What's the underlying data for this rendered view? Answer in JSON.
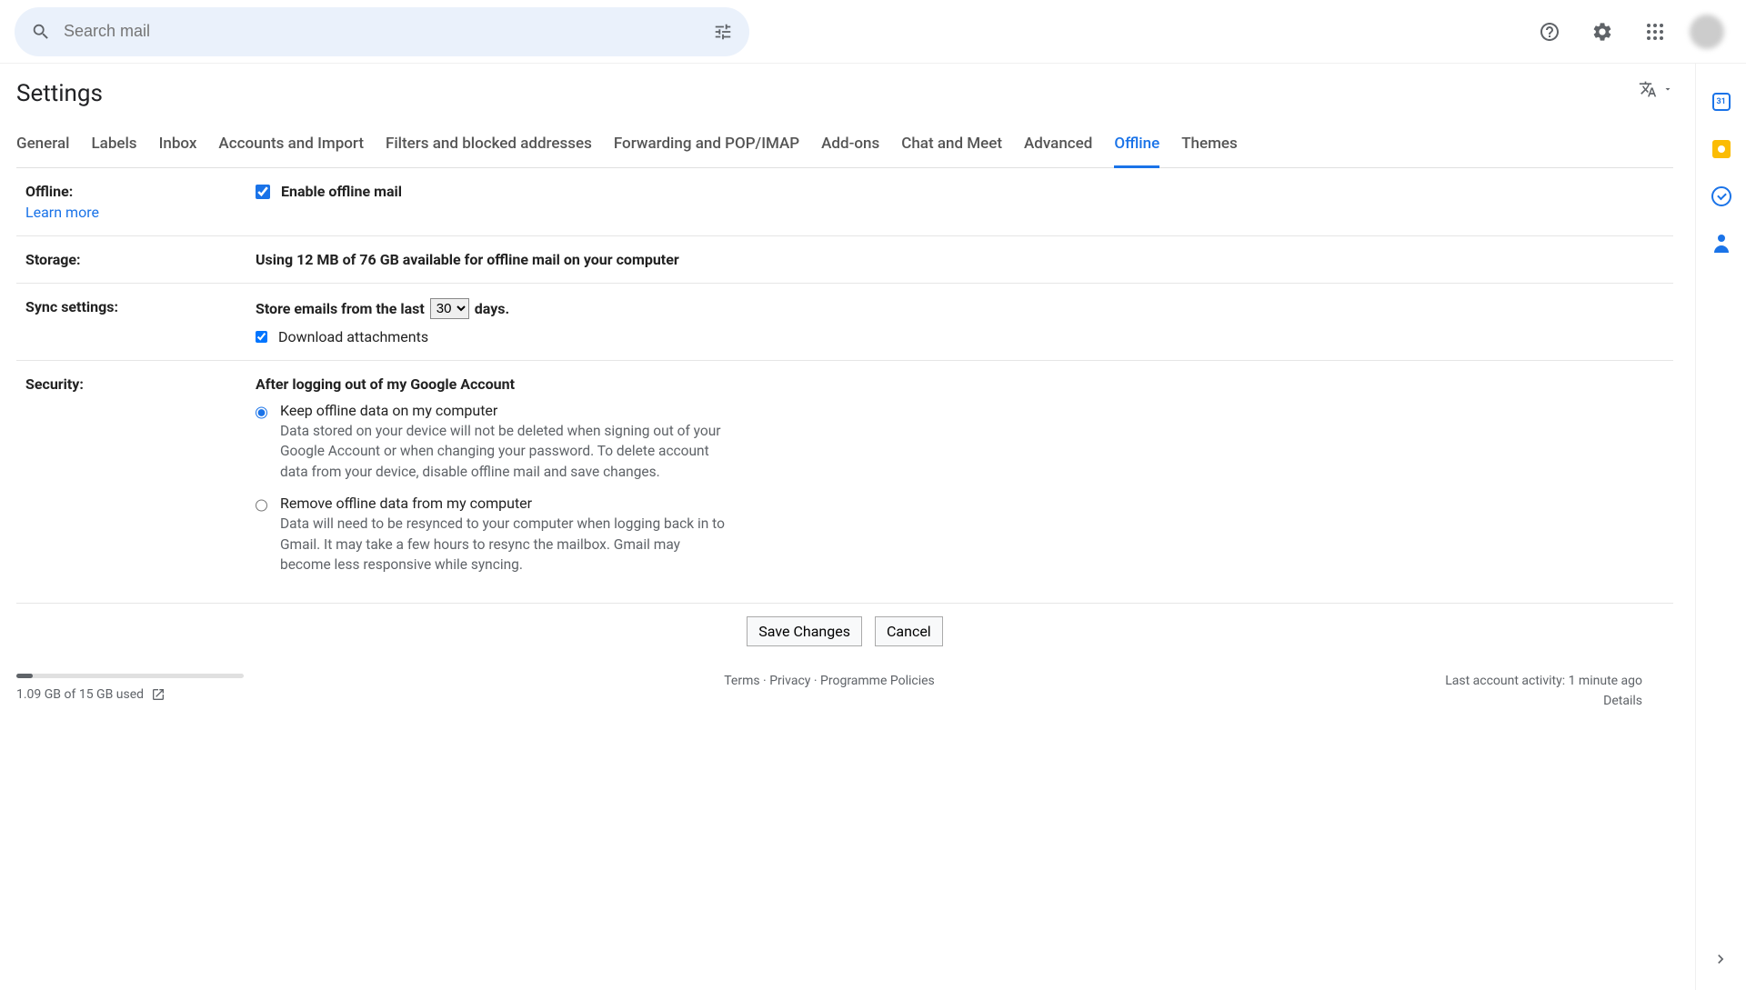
{
  "header": {
    "search_placeholder": "Search mail"
  },
  "page": {
    "title": "Settings"
  },
  "tabs": [
    {
      "label": "General",
      "active": false
    },
    {
      "label": "Labels",
      "active": false
    },
    {
      "label": "Inbox",
      "active": false
    },
    {
      "label": "Accounts and Import",
      "active": false
    },
    {
      "label": "Filters and blocked addresses",
      "active": false
    },
    {
      "label": "Forwarding and POP/IMAP",
      "active": false
    },
    {
      "label": "Add-ons",
      "active": false
    },
    {
      "label": "Chat and Meet",
      "active": false
    },
    {
      "label": "Advanced",
      "active": false
    },
    {
      "label": "Offline",
      "active": true
    },
    {
      "label": "Themes",
      "active": false
    }
  ],
  "offline": {
    "label": "Offline:",
    "learn_more": "Learn more",
    "enable_label": "Enable offline mail",
    "enable_checked": true
  },
  "storage": {
    "label": "Storage:",
    "text": "Using 12 MB of 76 GB available for offline mail on your computer"
  },
  "sync": {
    "label": "Sync settings:",
    "prefix": "Store emails from the last",
    "days_value": "30",
    "suffix": "days.",
    "download_label": "Download attachments",
    "download_checked": true
  },
  "security": {
    "label": "Security:",
    "heading": "After logging out of my Google Account",
    "option1_title": "Keep offline data on my computer",
    "option1_desc": "Data stored on your device will not be deleted when signing out of your Google Account or when changing your password. To delete account data from your device, disable offline mail and save changes.",
    "option2_title": "Remove offline data from my computer",
    "option2_desc": "Data will need to be resynced to your computer when logging back in to Gmail. It may take a few hours to resync the mailbox. Gmail may become less responsive while syncing.",
    "selected": "keep"
  },
  "buttons": {
    "save": "Save Changes",
    "cancel": "Cancel"
  },
  "footer": {
    "storage_used": "1.09 GB of 15 GB used",
    "terms": "Terms",
    "privacy": "Privacy",
    "policies": "Programme Policies",
    "dot": " · ",
    "activity": "Last account activity: 1 minute ago",
    "details": "Details"
  }
}
